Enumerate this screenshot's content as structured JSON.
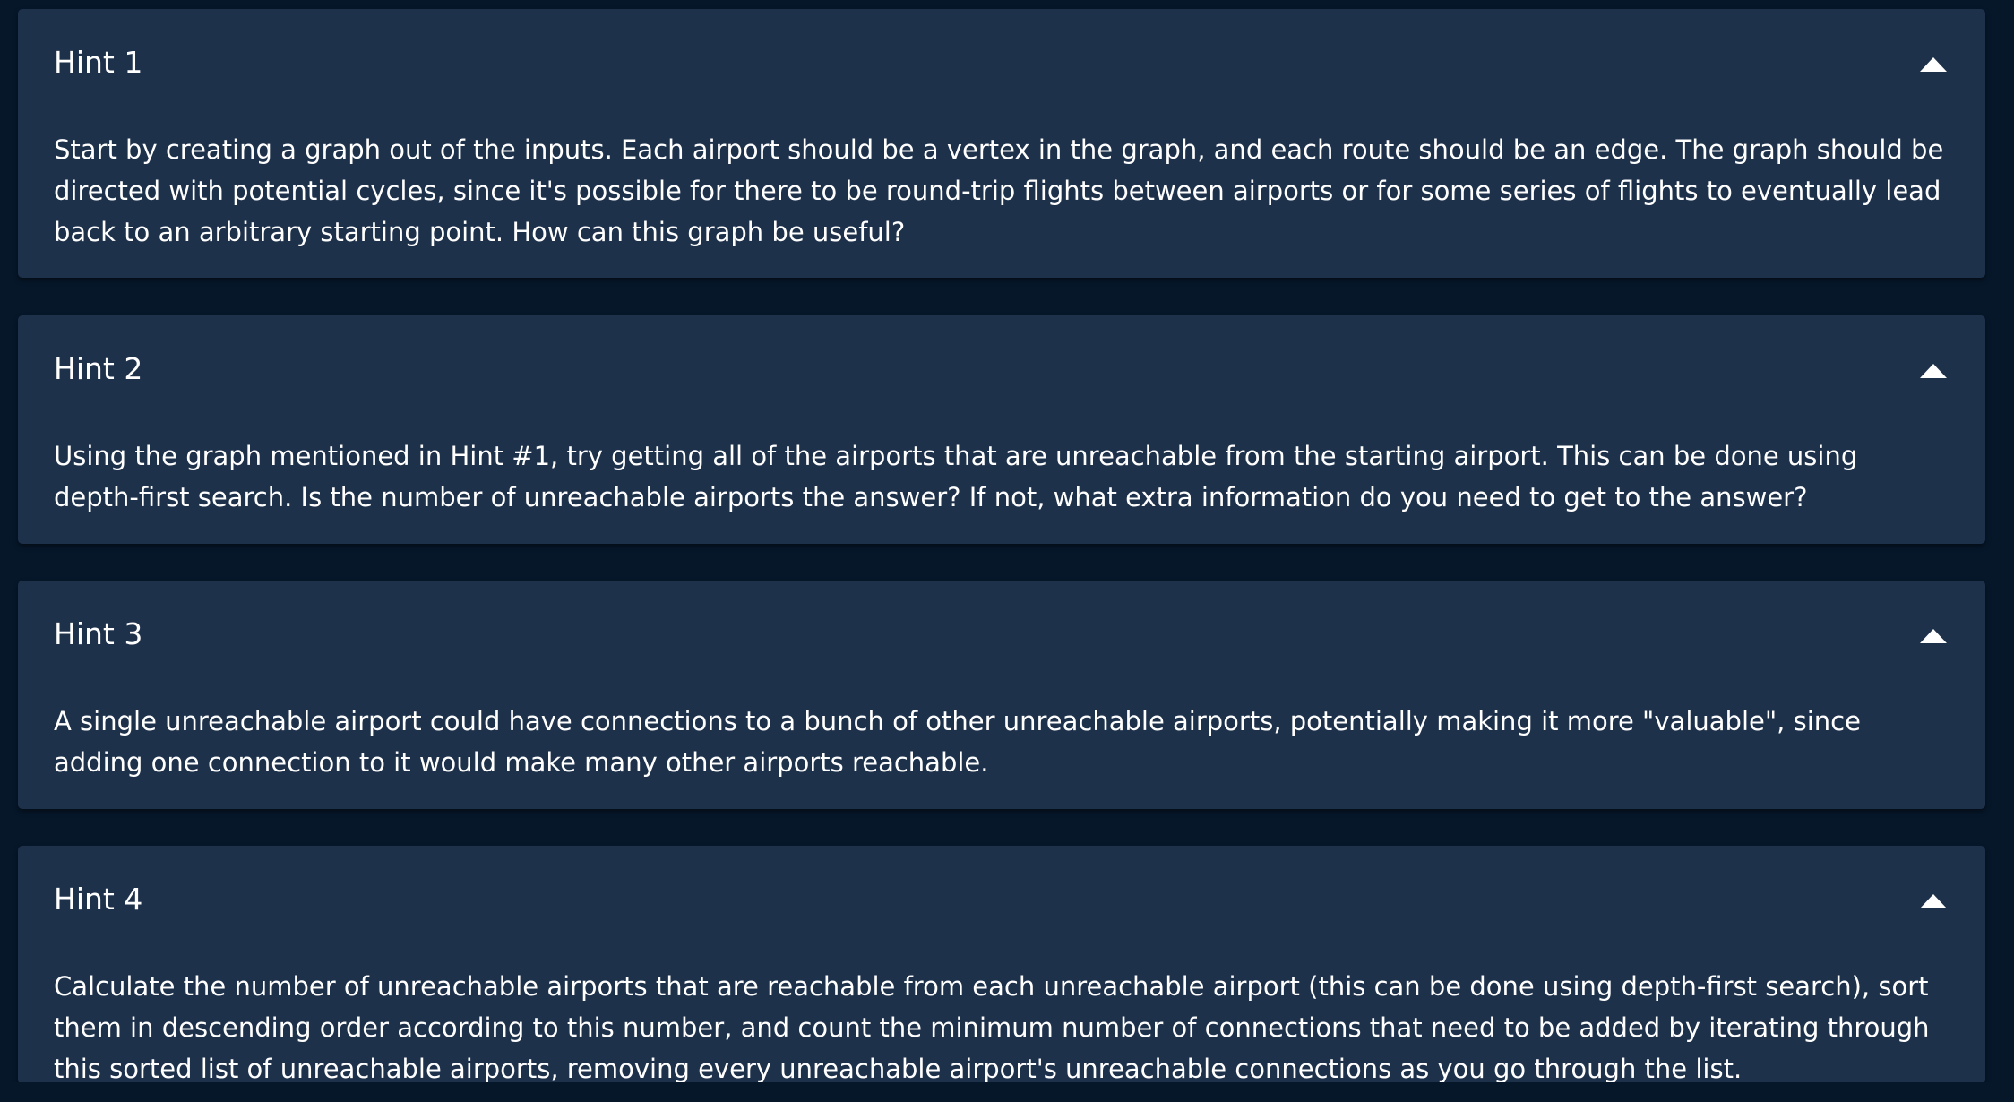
{
  "hints": [
    {
      "title": "Hint 1",
      "body": "Start by creating a graph out of the inputs. Each airport should be a vertex in the graph, and each route should be an edge. The graph should be directed with potential cycles, since it's possible for there to be round-trip flights between airports or for some series of flights to eventually lead back to an arbitrary starting point. How can this graph be useful?",
      "toggle_icon": "caret-up-icon"
    },
    {
      "title": "Hint 2",
      "body": "Using the graph mentioned in Hint #1, try getting all of the airports that are unreachable from the starting airport. This can be done using depth-first search. Is the number of unreachable airports the answer? If not, what extra information do you need to get to the answer?",
      "toggle_icon": "caret-up-icon"
    },
    {
      "title": "Hint 3",
      "body": "A single unreachable airport could have connections to a bunch of other unreachable airports, potentially making it more \"valuable\", since adding one connection to it would make many other airports reachable.",
      "toggle_icon": "caret-up-icon"
    },
    {
      "title": "Hint 4",
      "body": "Calculate the number of unreachable airports that are reachable from each unreachable airport (this can be done using depth-first search), sort them in descending order according to this number, and count the minimum number of connections that need to be added by iterating through this sorted list of unreachable airports, removing every unreachable airport's unreachable connections as you go through the list.",
      "toggle_icon": "caret-up-icon"
    }
  ],
  "colors": {
    "page_background": "#06172a",
    "card_background": "#1e314b",
    "text": "#ffffff"
  }
}
